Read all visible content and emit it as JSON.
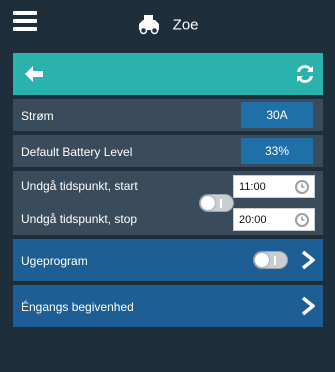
{
  "header": {
    "title": "Zoe",
    "menu_icon": "hamburger-menu-icon",
    "car_icon": "car-icon"
  },
  "nav": {
    "back_icon": "back-arrow-icon",
    "refresh_icon": "refresh-icon",
    "accent_color": "#2ab2ac"
  },
  "settings": {
    "current": {
      "label": "Strøm",
      "value": "30A"
    },
    "default_battery": {
      "label": "Default Battery Level",
      "value": "33%"
    },
    "avoid_start": {
      "label": "Undgå tidspunkt, start",
      "value": "11:00"
    },
    "avoid_stop": {
      "label": "Undgå tidspunkt, stop",
      "value": "20:00"
    },
    "avoid_toggle_on": false
  },
  "week_program": {
    "label": "Ugeprogram",
    "toggle_on": false
  },
  "one_time_event": {
    "label": "Éngangs begivenhed"
  },
  "colors": {
    "background": "#1f2e3b",
    "row": "#3a4b5c",
    "value_box": "#1f6fa8",
    "blue_row": "#1d5f95"
  }
}
